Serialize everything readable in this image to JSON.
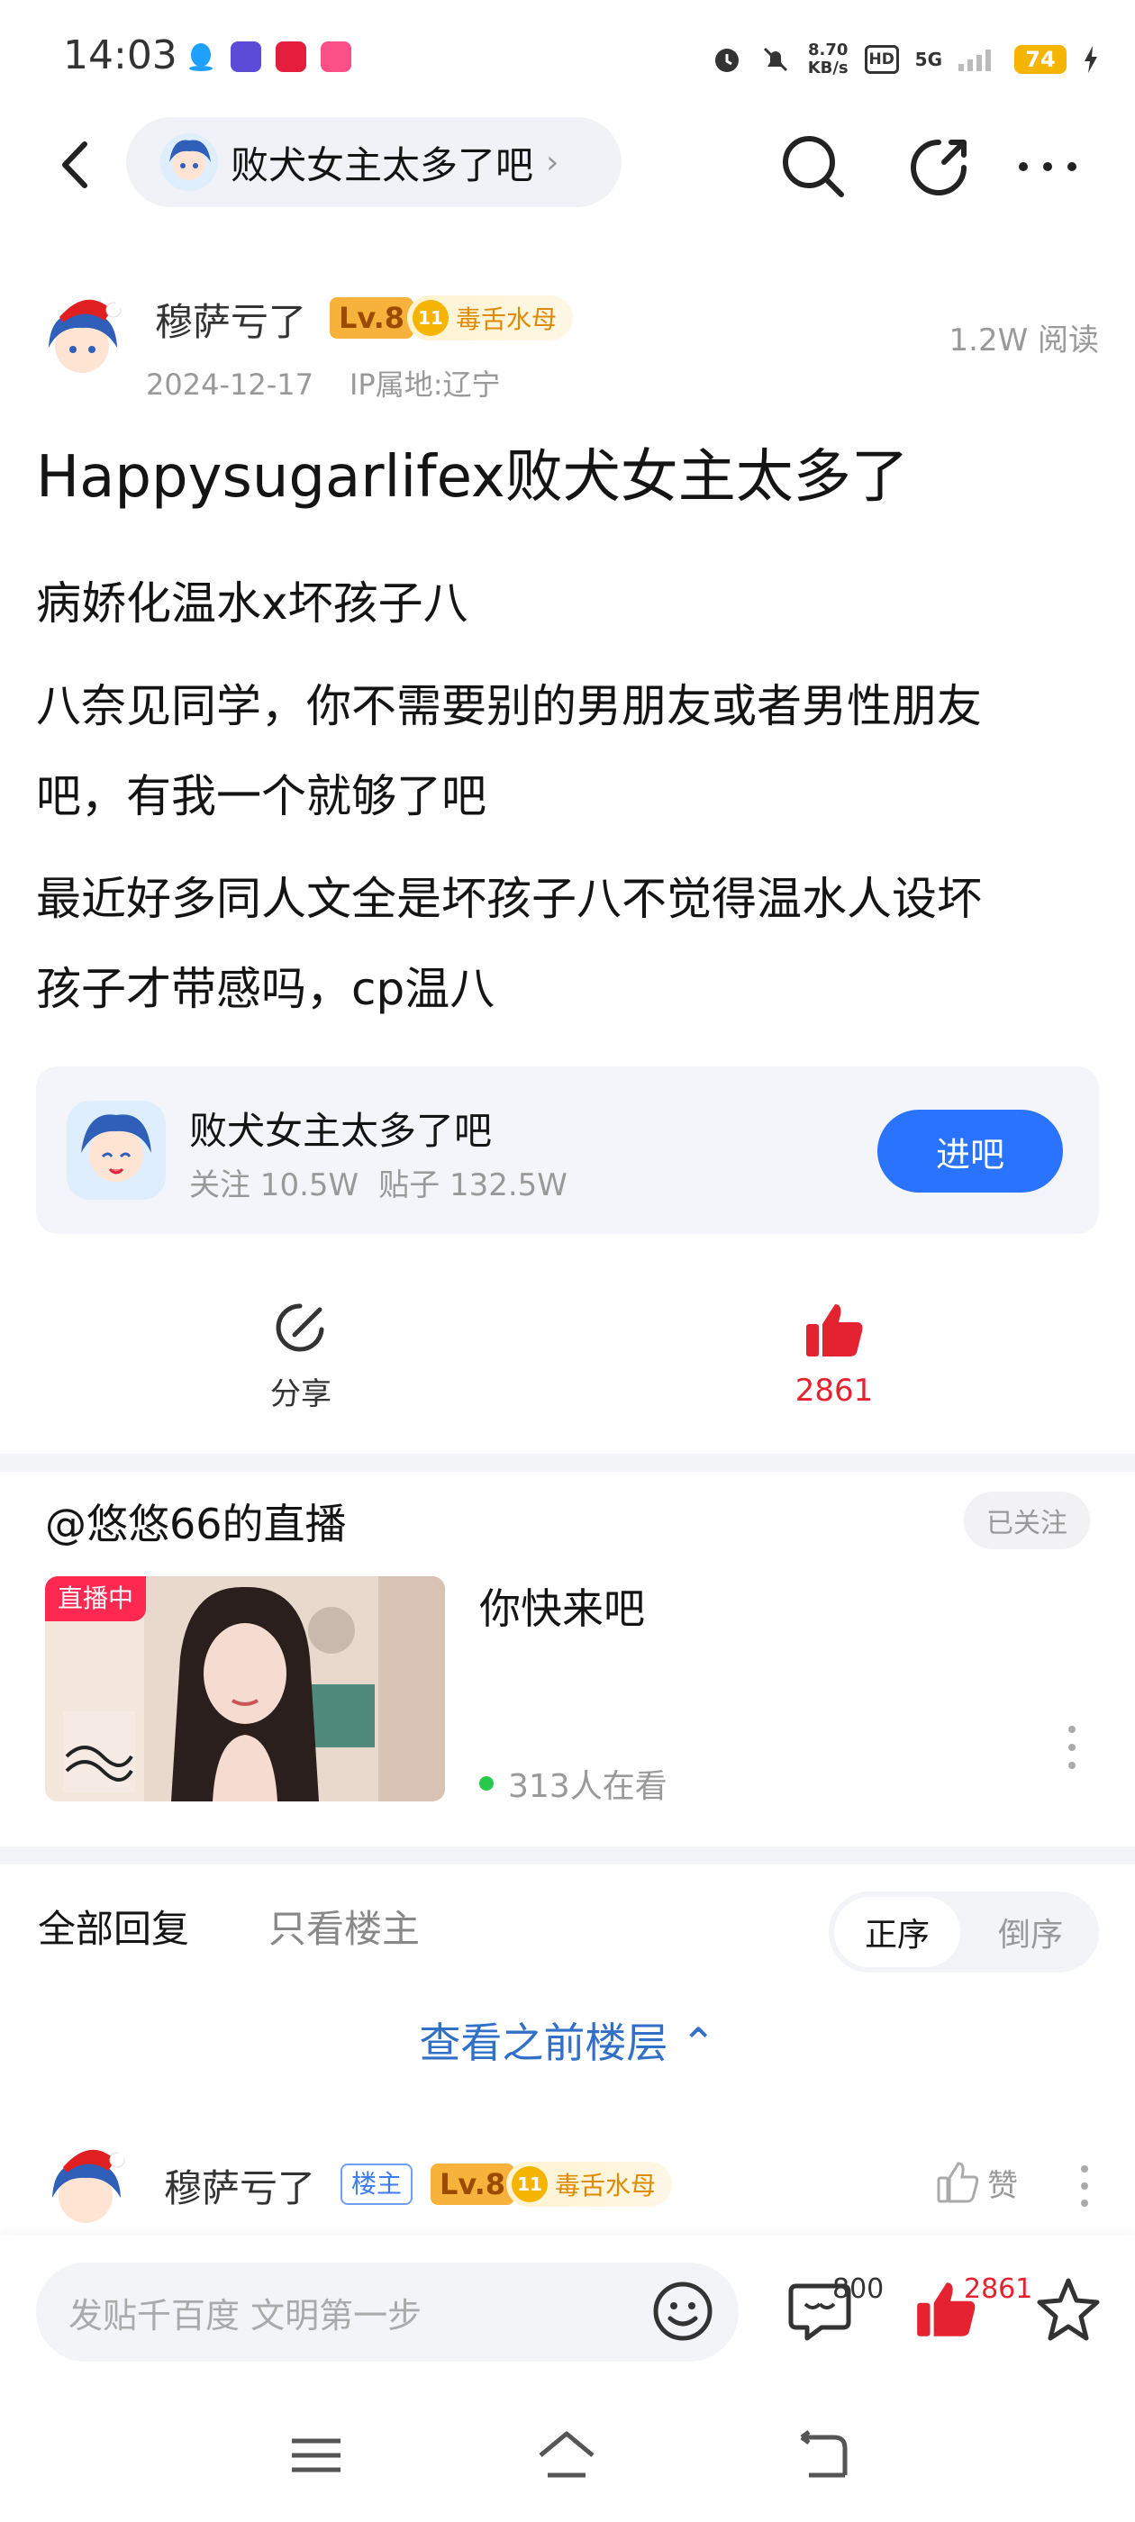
{
  "status_bar": {
    "time": "14:03",
    "net_speed": "8.70",
    "net_unit": "KB/s",
    "hd": "HD",
    "signal": "5G",
    "battery": "74"
  },
  "nav": {
    "forum_name": "败犬女主太多了吧",
    "chevron": "›"
  },
  "post": {
    "author": "穆萨亏了",
    "level": "Lv.8",
    "title_badge_level": "11",
    "title_badge": "毒舌水母",
    "read_count": "1.2W 阅读",
    "date": "2024-12-17",
    "ip": "IP属地:辽宁",
    "title": "Happysugarlifex败犬女主太多了",
    "paragraphs": [
      "病娇化温水x坏孩子八",
      "八奈见同学，你不需要别的男朋友或者男性朋友",
      "吧，有我一个就够了吧",
      "最近好多同人文全是坏孩子八不觉得温水人设坏",
      "孩子才带感吗，cp温八"
    ]
  },
  "forum_card": {
    "name": "败犬女主太多了吧",
    "followers": "关注 10.5W",
    "posts": "贴子 132.5W",
    "enter_label": "进吧"
  },
  "actions": {
    "share_label": "分享",
    "like_count": "2861"
  },
  "live": {
    "title": "@悠悠66的直播",
    "followed_label": "已关注",
    "tag": "直播中",
    "text": "你快来吧",
    "viewers": "313人在看"
  },
  "replies": {
    "tab_all": "全部回复",
    "tab_host": "只看楼主",
    "order_asc": "正序",
    "order_desc": "倒序",
    "view_previous": "查看之前楼层 ⌃",
    "first": {
      "author": "穆萨亏了",
      "host_badge": "楼主",
      "level": "Lv.8",
      "title_badge_level": "11",
      "title_badge": "毒舌水母",
      "like_label": "赞"
    }
  },
  "bottom_bar": {
    "input_placeholder": "发贴千百度 文明第一步",
    "comment_count": "800",
    "like_count": "2861"
  },
  "colors": {
    "accent_blue": "#2a73ff",
    "like_red": "#e5222f",
    "link_blue": "#3270c8",
    "live_red": "#ff2850"
  }
}
